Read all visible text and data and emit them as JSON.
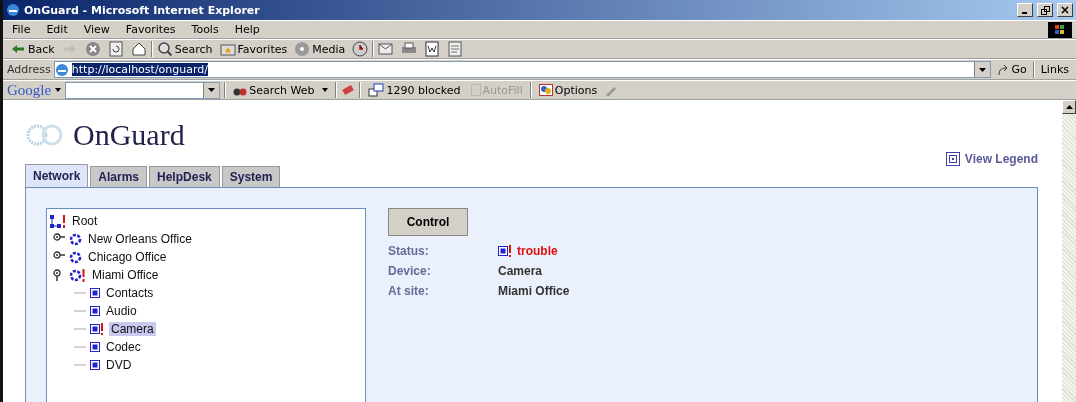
{
  "window": {
    "title": "OnGuard - Microsoft Internet Explorer"
  },
  "menu": [
    "File",
    "Edit",
    "View",
    "Favorites",
    "Tools",
    "Help"
  ],
  "toolbar": [
    {
      "kind": "back",
      "label": "Back",
      "disabled": false
    },
    {
      "kind": "forward",
      "disabled": true
    },
    {
      "kind": "stop",
      "disabled": false
    },
    {
      "kind": "refresh",
      "disabled": false
    },
    {
      "kind": "home",
      "disabled": false
    },
    {
      "kind": "search",
      "label": "Search",
      "disabled": false
    },
    {
      "kind": "favorites",
      "label": "Favorites",
      "disabled": false
    },
    {
      "kind": "media",
      "label": "Media",
      "disabled": false
    },
    {
      "kind": "history",
      "disabled": false
    },
    {
      "kind": "mail",
      "disabled": false
    },
    {
      "kind": "print",
      "disabled": false
    },
    {
      "kind": "edit",
      "disabled": false
    },
    {
      "kind": "discuss",
      "disabled": false
    }
  ],
  "address": {
    "label": "Address",
    "value": "http://localhost/onguard/",
    "go": "Go",
    "links": "Links"
  },
  "google_bar": {
    "brand": "Google",
    "search_web": "Search Web",
    "blocked": "1290 blocked",
    "autofill": {
      "label": "AutoFill",
      "disabled": true
    },
    "options": "Options"
  },
  "page": {
    "logo": "OnGuard",
    "view_legend": "View Legend",
    "tabs": [
      {
        "label": "Network",
        "selected": true
      },
      {
        "label": "Alarms",
        "selected": false
      },
      {
        "label": "HelpDesk",
        "selected": false
      },
      {
        "label": "System",
        "selected": false
      }
    ],
    "tree": [
      {
        "kind": "root",
        "label": "Root",
        "alert": true,
        "children": [
          {
            "kind": "site",
            "label": "New Orleans Office",
            "alert": false,
            "expanded": false
          },
          {
            "kind": "site",
            "label": "Chicago Office",
            "alert": false,
            "expanded": false
          },
          {
            "kind": "site",
            "label": "Miami Office",
            "alert": true,
            "expanded": true,
            "children": [
              {
                "kind": "device",
                "label": "Contacts",
                "alert": false,
                "selected": false
              },
              {
                "kind": "device",
                "label": "Audio",
                "alert": false,
                "selected": false
              },
              {
                "kind": "device",
                "label": "Camera",
                "alert": true,
                "selected": true
              },
              {
                "kind": "device",
                "label": "Codec",
                "alert": false,
                "selected": false
              },
              {
                "kind": "device",
                "label": "DVD",
                "alert": false,
                "selected": false
              }
            ]
          }
        ]
      }
    ],
    "control_button": "Control",
    "details": [
      {
        "label": "Status:",
        "value": "trouble",
        "alert": true
      },
      {
        "label": "Device:",
        "value": "Camera",
        "alert": false
      },
      {
        "label": "At site:",
        "value": "Miami Office",
        "alert": false
      }
    ]
  }
}
